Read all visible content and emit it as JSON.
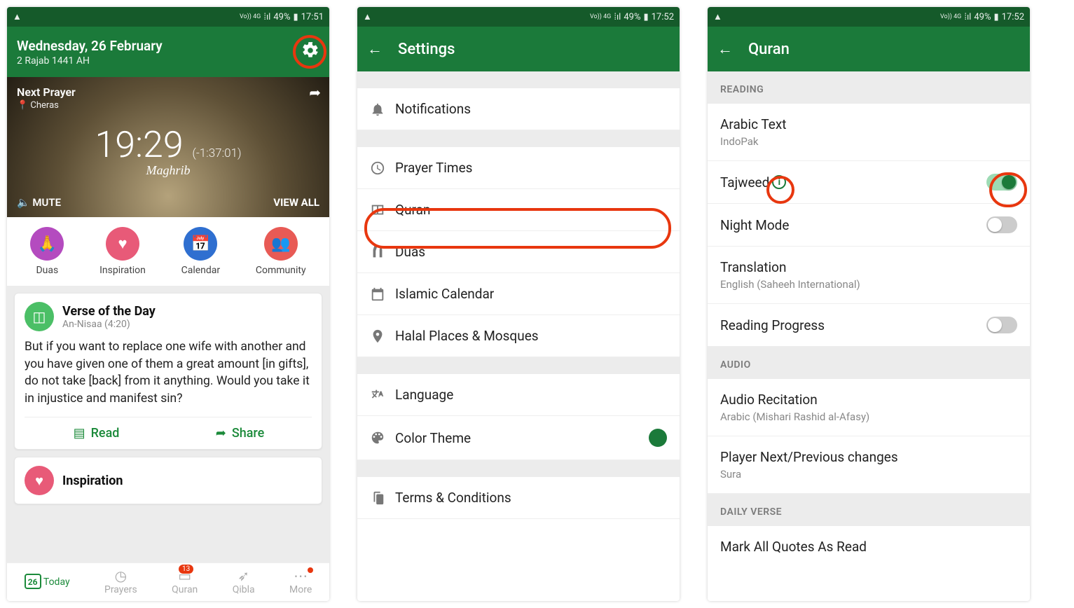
{
  "status": {
    "warning_icon": "▲",
    "net_label": "Vo)) 4G",
    "lte": "LTE",
    "signal": "⁞ıl",
    "battery": "49%"
  },
  "screen1": {
    "status_time": "17:51",
    "date_line": "Wednesday, 26 February",
    "hijri_line": "2 Rajab 1441 AH",
    "next_prayer_label": "Next Prayer",
    "location": "Cheras",
    "time": "19:29",
    "countdown": "(-1:37:01)",
    "prayer_name": "Maghrib",
    "mute": "MUTE",
    "view_all": "VIEW ALL",
    "quick": [
      {
        "label": "Duas",
        "color": "#b44bbf",
        "glyph": "🙏"
      },
      {
        "label": "Inspiration",
        "color": "#e85a78",
        "glyph": "♥"
      },
      {
        "label": "Calendar",
        "color": "#2f6fd0",
        "glyph": "📅"
      },
      {
        "label": "Community",
        "color": "#e85a55",
        "glyph": "👥"
      }
    ],
    "verse_card": {
      "title": "Verse of the Day",
      "sub": "An-Nisaa (4:20)",
      "text": "But if you want to replace one wife with another and you have given one of them a great amount [in gifts], do not take [back] from it anything. Would you take it in injustice and manifest sin?",
      "read": "Read",
      "share": "Share"
    },
    "inspiration_card": "Inspiration",
    "nav": {
      "today": "Today",
      "today_day": "26",
      "prayers": "Prayers",
      "quran": "Quran",
      "quran_badge": "13",
      "qibla": "Qibla",
      "more": "More"
    }
  },
  "screen2": {
    "status_time": "17:52",
    "title": "Settings",
    "items": {
      "notifications": "Notifications",
      "prayer_times": "Prayer Times",
      "quran": "Quran",
      "duas": "Duas",
      "islamic_calendar": "Islamic Calendar",
      "halal": "Halal Places & Mosques",
      "language": "Language",
      "color_theme": "Color Theme",
      "terms": "Terms & Conditions"
    }
  },
  "screen3": {
    "status_time": "17:52",
    "title": "Quran",
    "section_reading": "READING",
    "section_audio": "AUDIO",
    "section_daily": "DAILY VERSE",
    "arabic_text": "Arabic Text",
    "arabic_text_sub": "IndoPak",
    "tajweed": "Tajweed",
    "night_mode": "Night Mode",
    "translation": "Translation",
    "translation_sub": "English (Saheeh International)",
    "reading_progress": "Reading Progress",
    "audio_recitation": "Audio Recitation",
    "audio_recitation_sub": "Arabic (Mishari Rashid al-Afasy)",
    "player_next": "Player Next/Previous changes",
    "player_next_sub": "Sura",
    "mark_all": "Mark All Quotes As Read"
  }
}
